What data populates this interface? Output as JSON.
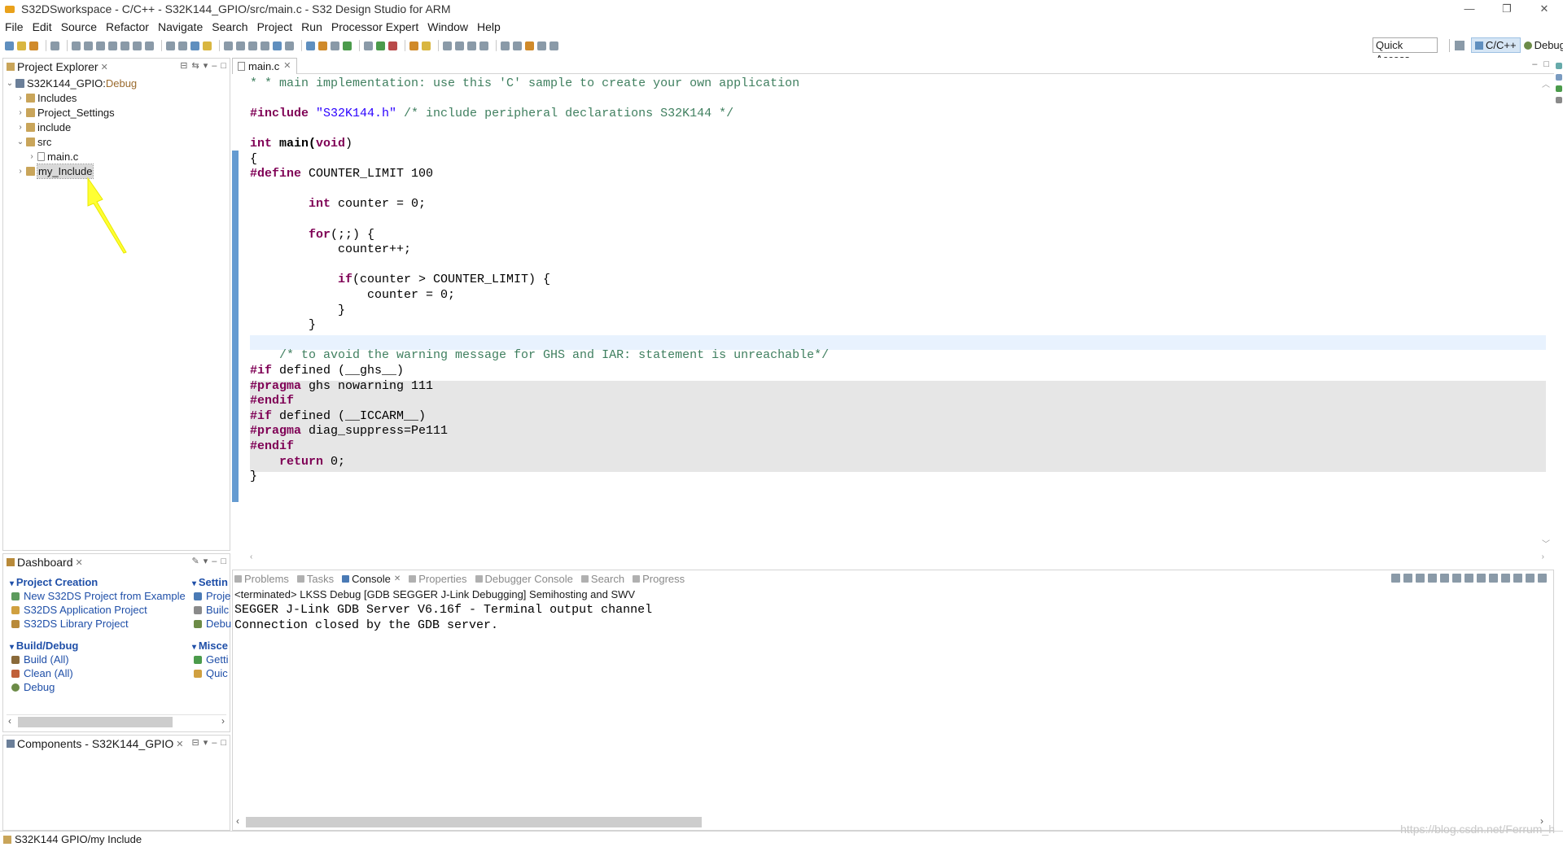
{
  "window": {
    "title": "S32DSworkspace - C/C++ - S32K144_GPIO/src/main.c - S32 Design Studio for ARM",
    "controls": [
      "—",
      "❐",
      "✕"
    ]
  },
  "menu": [
    "File",
    "Edit",
    "Source",
    "Refactor",
    "Navigate",
    "Search",
    "Project",
    "Run",
    "Processor Expert",
    "Window",
    "Help"
  ],
  "toolbar": {
    "quick_access": "Quick Access",
    "perspectives": {
      "cpp": "C/C++",
      "debug": "Debug"
    }
  },
  "project_explorer": {
    "title": "Project Explorer",
    "project_name": "S32K144_GPIO:",
    "project_config": " Debug",
    "items": [
      "Includes",
      "Project_Settings",
      "include",
      "src",
      "main.c",
      "my_Include"
    ]
  },
  "dashboard": {
    "title": "Dashboard",
    "sections": {
      "project_creation": "Project Creation",
      "settings": "Settin",
      "build_debug": "Build/Debug",
      "misc": "Misce"
    },
    "links": {
      "new_from_example": "New S32DS Project from Example",
      "app_project": "S32DS Application Project",
      "lib_project": "S32DS Library Project",
      "build_all": "Build  (All)",
      "clean_all": "Clean  (All)",
      "debug": "Debug",
      "proj": "Proje",
      "build": "Builc",
      "debu": "Debu",
      "getting": "Getti",
      "quick": "Quic"
    }
  },
  "components": {
    "title": "Components - S32K144_GPIO"
  },
  "editor": {
    "tab": "main.c",
    "code": {
      "l1": "* * main implementation: use this 'C' sample to create your own application",
      "l4_kw": "#include ",
      "l4_str": "\"S32K144.h\"",
      "l4_cm": " /* include peripheral declarations S32K144 */",
      "l6_kw": "int",
      "l6_rest_fn": " main(",
      "l6_void": "void",
      "l6_end": ")",
      "l7": "{",
      "l8_kw": "#define",
      "l8_rest": " COUNTER_LIMIT 100",
      "l10_kw": "int",
      "l10_rest": " counter = 0;",
      "l12_kw": "for",
      "l12_rest": "(;;) {",
      "l13": "counter++;",
      "l15_kw": "if",
      "l15_rest": "(counter > COUNTER_LIMIT) {",
      "l16": "counter = 0;",
      "l17": "}",
      "l18": "}",
      "l20_cm": "/* to avoid the warning message for GHS and IAR: statement is unreachable*/",
      "l21_kw": "#if",
      "l21_rest": " defined (__ghs__)",
      "l22_kw": "#pragma",
      "l22_rest": " ghs nowarning 111",
      "l23_kw": "#endif",
      "l24_kw": "#if",
      "l24_rest": " defined (__ICCARM__)",
      "l25_kw": "#pragma",
      "l25_rest": " diag_suppress=Pe111",
      "l26_kw": "#endif",
      "l27_kw": "return",
      "l27_rest": " 0;",
      "l28": "}"
    }
  },
  "console": {
    "tabs": [
      "Problems",
      "Tasks",
      "Console",
      "Properties",
      "Debugger Console",
      "Search",
      "Progress"
    ],
    "active_tab": "Console",
    "description": "<terminated> LKSS Debug [GDB SEGGER J-Link Debugging] Semihosting and SWV",
    "lines": [
      "SEGGER J-Link GDB Server V6.16f - Terminal output channel",
      "Connection closed by the GDB server."
    ]
  },
  "status": {
    "path": "S32K144 GPIO/my Include",
    "watermark": "https://blog.csdn.net/Ferrum_h"
  },
  "colors": {
    "keyword": "#7f0055",
    "string": "#2a00ff",
    "comment": "#3f7f5f",
    "link": "#1f4fa8",
    "annotation_arrow": "#ffff33"
  }
}
